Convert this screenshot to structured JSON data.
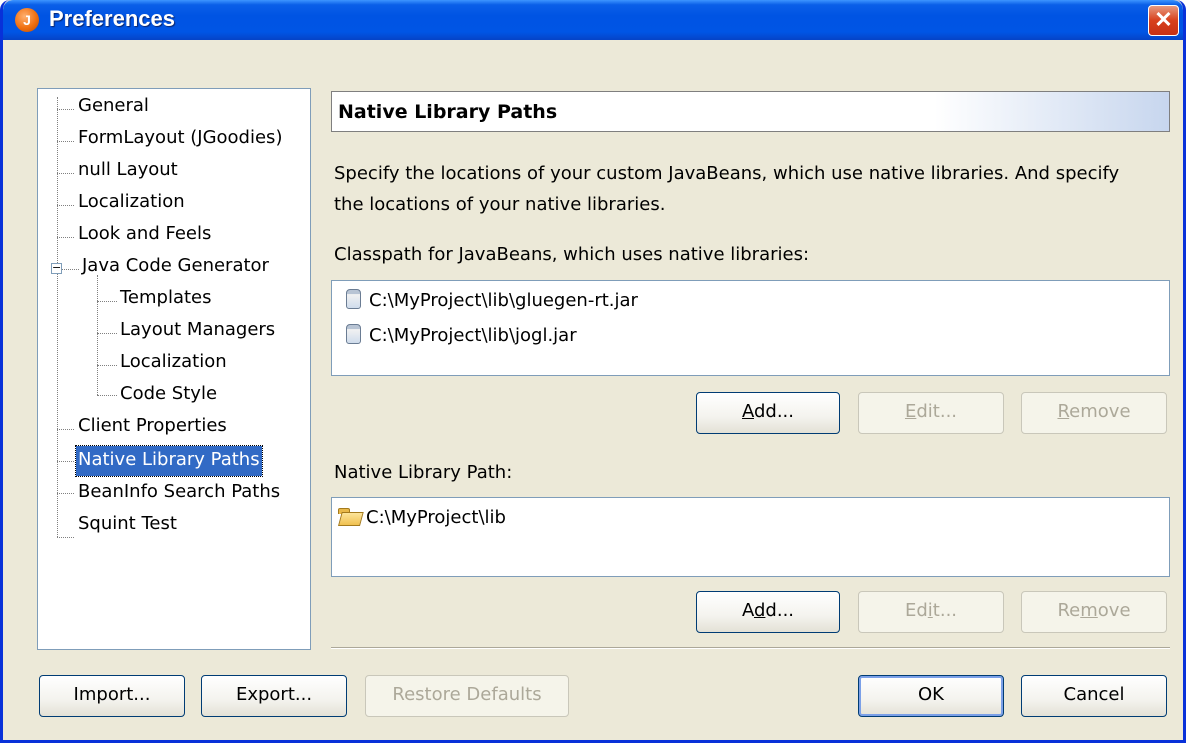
{
  "window": {
    "title": "Preferences",
    "icon_letter": "J",
    "close_symbol": "✕"
  },
  "tree": {
    "items": [
      {
        "label": "General"
      },
      {
        "label": "FormLayout (JGoodies)"
      },
      {
        "label": "null Layout"
      },
      {
        "label": "Localization"
      },
      {
        "label": "Look and Feels"
      },
      {
        "label": "Java Code Generator",
        "expanded": true
      },
      {
        "label": "Templates"
      },
      {
        "label": "Layout Managers"
      },
      {
        "label": "Localization"
      },
      {
        "label": "Code Style"
      },
      {
        "label": "Client Properties"
      },
      {
        "label": "Native Library Paths",
        "selected": true
      },
      {
        "label": "BeanInfo Search Paths"
      },
      {
        "label": "Squint Test"
      }
    ],
    "expander_symbol": "−"
  },
  "panel": {
    "title": "Native Library Paths",
    "description": "Specify the locations of your custom JavaBeans, which use native libraries. And specify the locations of your native libraries.",
    "classpath": {
      "label": "Classpath for JavaBeans, which uses native libraries:",
      "items": [
        "C:\\MyProject\\lib\\gluegen-rt.jar",
        "C:\\MyProject\\lib\\jogl.jar"
      ],
      "buttons": {
        "add_pre": "",
        "add_mn": "A",
        "add_post": "dd...",
        "edit_pre": "",
        "edit_mn": "E",
        "edit_post": "dit...",
        "remove_pre": "",
        "remove_mn": "R",
        "remove_post": "emove"
      }
    },
    "native": {
      "label": "Native Library Path:",
      "items": [
        "C:\\MyProject\\lib"
      ],
      "buttons": {
        "add_pre": "A",
        "add_mn": "d",
        "add_post": "d...",
        "edit_pre": "Ed",
        "edit_mn": "i",
        "edit_post": "t...",
        "remove_pre": "Re",
        "remove_mn": "m",
        "remove_post": "ove"
      }
    }
  },
  "footer": {
    "import_label": "Import...",
    "export_label": "Export...",
    "restore_label": "Restore Defaults",
    "ok_label": "OK",
    "cancel_label": "Cancel"
  },
  "colors": {
    "titlebar": "#0054e3",
    "selection": "#316ac5",
    "dialog_bg": "#ece9d8",
    "close": "#d8401c"
  }
}
